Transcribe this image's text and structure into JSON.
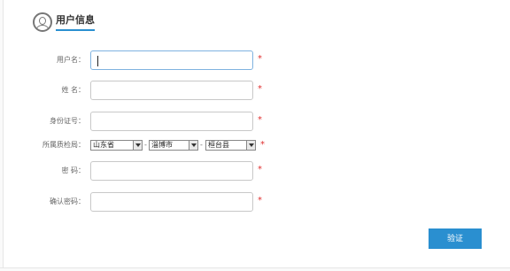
{
  "header": {
    "title": "用户信息",
    "icon": "user-icon"
  },
  "form": {
    "username": {
      "label": "用户名：",
      "value": ""
    },
    "name": {
      "label": "姓 名：",
      "value": ""
    },
    "id_number": {
      "label": "身份证号：",
      "value": ""
    },
    "location": {
      "label": "所属质检局：",
      "province": "山东省",
      "city": "淄博市",
      "county": "桓台县",
      "separator": "-"
    },
    "password": {
      "label": "密 码：",
      "value": ""
    },
    "confirm_password": {
      "label": "确认密码：",
      "value": ""
    },
    "required_mark": "*"
  },
  "actions": {
    "submit_label": "验证"
  },
  "colors": {
    "accent": "#2a8fd0",
    "required": "#e03030"
  }
}
